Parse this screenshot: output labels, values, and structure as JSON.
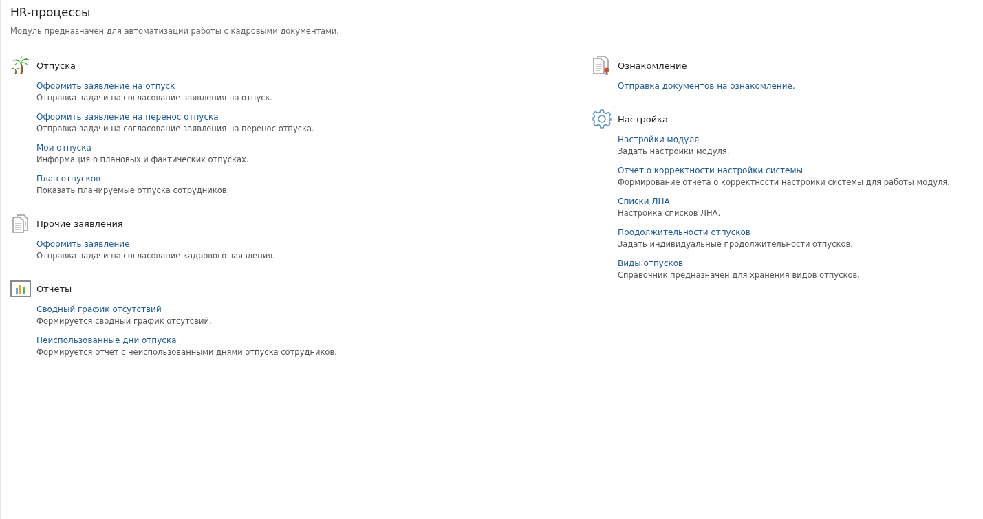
{
  "page": {
    "title": "HR-процессы",
    "description": "Модуль предназначен для автоматизации работы с кадровыми документами."
  },
  "columns": [
    {
      "sections": [
        {
          "kind": "palm",
          "title": "Отпуска",
          "items": [
            {
              "link": "Оформить заявление на отпуск",
              "description": "Отправка задачи на согласование заявления на отпуск."
            },
            {
              "link": "Оформить заявление на перенос отпуска",
              "description": "Отправка задачи на согласование заявления на перенос отпуска."
            },
            {
              "link": "Мои отпуска",
              "description": "Информация о плановых и фактических отпусках."
            },
            {
              "link": "План отпусков",
              "description": "Показать планируемые отпуска сотрудников."
            }
          ]
        },
        {
          "kind": "documents",
          "title": "Прочие заявления",
          "items": [
            {
              "link": "Оформить заявление",
              "description": "Отправка задачи на согласование кадрового заявления."
            }
          ]
        },
        {
          "kind": "chart",
          "title": "Отчеты",
          "items": [
            {
              "link": "Сводный график отсутствий",
              "description": "Формируется сводный график отсутсвий."
            },
            {
              "link": "Неиспользованные дни отпуска",
              "description": "Формируется отчет с неиспользованными днями отпуска сотрудников."
            }
          ]
        }
      ]
    },
    {
      "sections": [
        {
          "kind": "certificate",
          "title": "Ознакомление",
          "items": [
            {
              "link": "Отправка документов на ознакомление."
            }
          ]
        },
        {
          "kind": "gear",
          "title": "Настройка",
          "items": [
            {
              "link": "Настройки модуля",
              "description": "Задать настройки модуля."
            },
            {
              "link": "Отчет о корректности настройки системы",
              "description": "Формирование отчета о корректности настройки системы для работы модуля."
            },
            {
              "link": "Списки ЛНА",
              "description": "Настройка списков ЛНА."
            },
            {
              "link": "Продолжительности отпусков",
              "description": "Задать индивидуальные продолжительности отпусков."
            },
            {
              "link": "Виды отпусков",
              "description": "Справочник предназначен для хранения видов отпусков."
            }
          ]
        }
      ]
    }
  ]
}
